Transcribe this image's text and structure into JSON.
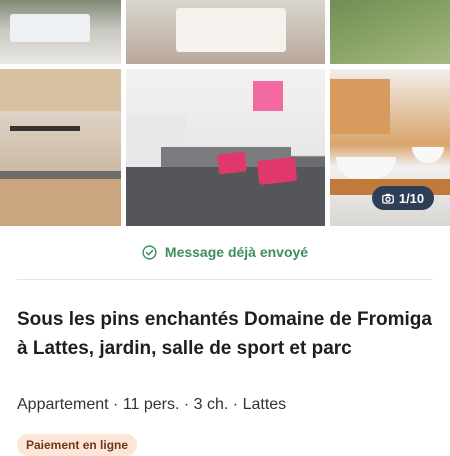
{
  "gallery": {
    "photos": [
      {
        "name": "garden-dining"
      },
      {
        "name": "bedroom-white"
      },
      {
        "name": "lawn"
      },
      {
        "name": "kitchen"
      },
      {
        "name": "bedroom-grey"
      },
      {
        "name": "bathroom"
      }
    ],
    "counter_text": "1/10",
    "counter_icon": "camera-icon"
  },
  "status": {
    "icon": "check-circle-icon",
    "text": "Message déjà envoyé",
    "color": "#3e8e5e"
  },
  "listing": {
    "title": "Sous les pins enchantés Domaine de Fromiga à Lattes, jardin, salle de sport et parc",
    "meta": "Appartement · 11 pers. · 3 ch. · Lattes",
    "badge": "Paiement en ligne"
  },
  "colors": {
    "badge_bg": "#fde5d8",
    "counter_bg": "#2f3e57",
    "accent_green": "#3e8e5e"
  }
}
